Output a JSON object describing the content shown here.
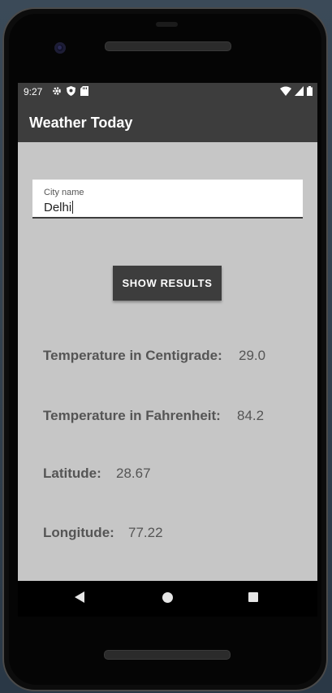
{
  "status_bar": {
    "time": "9:27",
    "left_icons": [
      "gear-icon",
      "shield-icon",
      "sd-card-icon"
    ],
    "right_icons": [
      "wifi-icon",
      "signal-icon",
      "battery-icon"
    ]
  },
  "app_bar": {
    "title": "Weather Today"
  },
  "city_field": {
    "label": "City name",
    "value": "Delhi"
  },
  "show_button": {
    "label": "SHOW RESULTS"
  },
  "results": [
    {
      "label": "Temperature in Centigrade:",
      "value": "29.0"
    },
    {
      "label": "Temperature in Fahrenheit:",
      "value": "84.2"
    },
    {
      "label": "Latitude:",
      "value": "28.67"
    },
    {
      "label": "Longitude:",
      "value": "77.22"
    }
  ],
  "nav": {
    "buttons": [
      "back-icon",
      "home-icon",
      "recents-icon"
    ]
  },
  "colors": {
    "app_bar": "#3d3d3d",
    "screen_bg": "#c6c6c6",
    "result_text": "#555555"
  }
}
